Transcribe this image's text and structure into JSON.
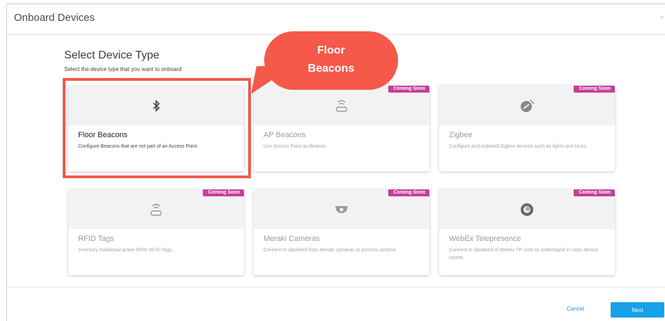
{
  "modal": {
    "title": "Onboard Devices",
    "close_glyph": "×"
  },
  "section": {
    "title": "Select Device Type",
    "subtitle": "Select the device type that you want to onboard"
  },
  "cards": [
    {
      "title": "Floor Beacons",
      "description": "Configure Beacons that are not part of an Access Point.",
      "icon": "bluetooth-icon",
      "badge": ""
    },
    {
      "title": "AP Beacons",
      "description": "Use Access Point as Beacon.",
      "icon": "access-point-icon",
      "badge": "Coming Soon"
    },
    {
      "title": "Zigbee",
      "description": "Configure and onboard Zigbee devices such as lights and locks.",
      "icon": "zigbee-icon",
      "badge": "Coming Soon"
    },
    {
      "title": "RFID Tags",
      "description": "Inventory traditional active RFID Wi-Fi Tags.",
      "icon": "rfid-tag-icon",
      "badge": "Coming Soon"
    },
    {
      "title": "Meraki Cameras",
      "description": "Connect to datafeed from Meraki cameras to process actions.",
      "icon": "camera-icon",
      "badge": "Coming Soon"
    },
    {
      "title": "WebEx Telepresence",
      "description": "Connect to datafeed of Webex TP units to understand in room device counts.",
      "icon": "webex-icon",
      "badge": "Coming Soon"
    }
  ],
  "callout": {
    "line1": "Floor",
    "line2": "Beacons"
  },
  "footer": {
    "cancel_label": "Cancel",
    "next_label": "Next"
  },
  "colors": {
    "badge": "#c63f9a",
    "callout": "#f4594a",
    "primary": "#17a1ea"
  }
}
